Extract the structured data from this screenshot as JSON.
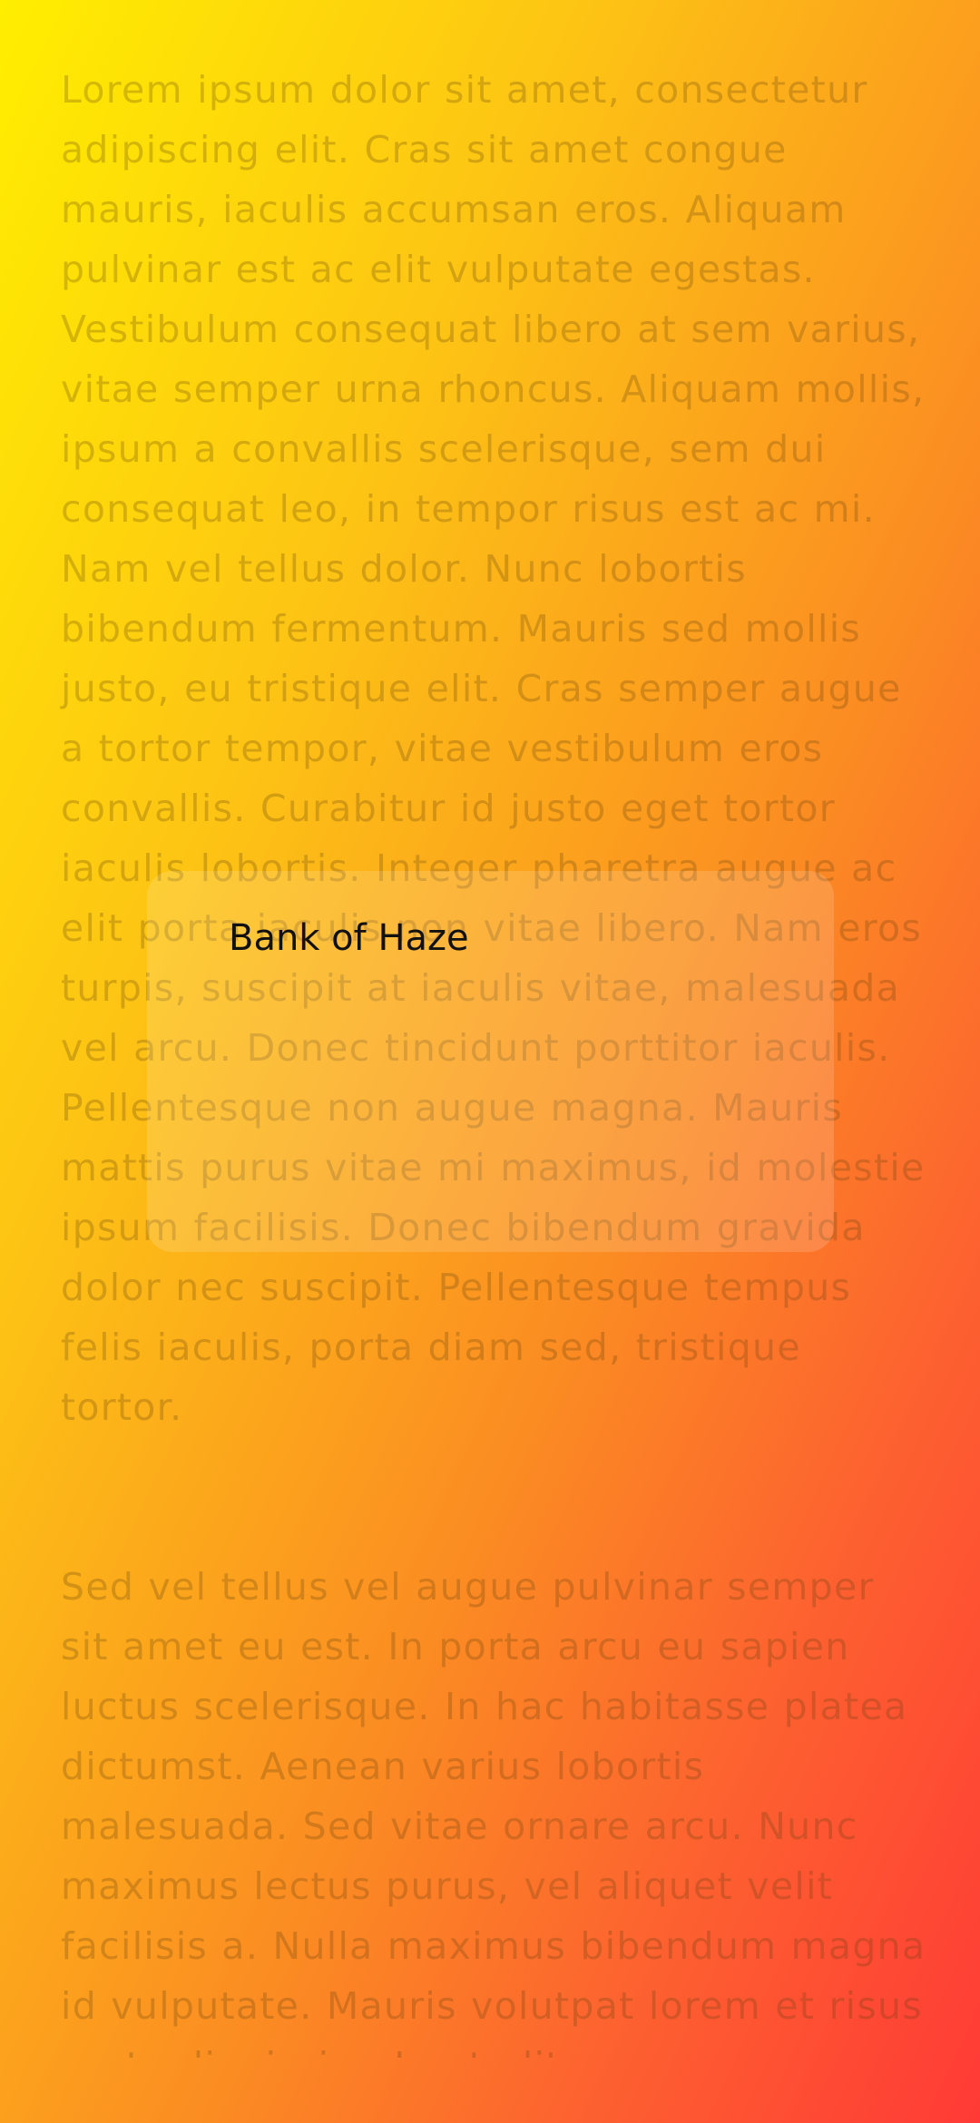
{
  "background": {
    "gradient_colors": [
      "#ffee00",
      "#fdc414",
      "#fb8d22",
      "#fd6030",
      "#ff3a36"
    ]
  },
  "content": {
    "paragraph_1": "Lorem ipsum dolor sit amet, consectetur adipiscing elit. Cras sit amet congue mauris, iaculis accumsan eros. Aliquam pulvinar est ac elit vulputate egestas. Vestibulum consequat libero at sem varius, vitae semper urna rhoncus. Aliquam mollis, ipsum a convallis scelerisque, sem dui consequat leo, in tempor risus est ac mi. Nam vel tellus dolor. Nunc lobortis bibendum fermentum. Mauris sed mollis justo, eu tristique elit. Cras semper augue a tortor tempor, vitae vestibulum eros convallis. Curabitur id justo eget tortor iaculis lobortis. Integer pharetra augue ac elit porta iaculis non vitae libero. Nam eros turpis, suscipit at iaculis vitae, malesuada vel arcu. Donec tincidunt porttitor iaculis. Pellentesque non augue magna. Mauris mattis purus vitae mi maximus, id molestie ipsum facilisis. Donec bibendum gravida dolor nec suscipit. Pellentesque tempus felis iaculis, porta diam sed, tristique tortor.",
    "paragraph_2": "Sed vel tellus vel augue pulvinar semper sit amet eu est. In porta arcu eu sapien luctus scelerisque. In hac habitasse platea dictumst. Aenean varius lobortis malesuada. Sed vitae ornare arcu. Nunc maximus lectus purus, vel aliquet velit facilisis a. Nulla maximus bibendum magna id vulputate. Mauris volutpat lorem et risus porta dignissim. In at elit"
  },
  "card": {
    "title": "Bank of Haze"
  }
}
